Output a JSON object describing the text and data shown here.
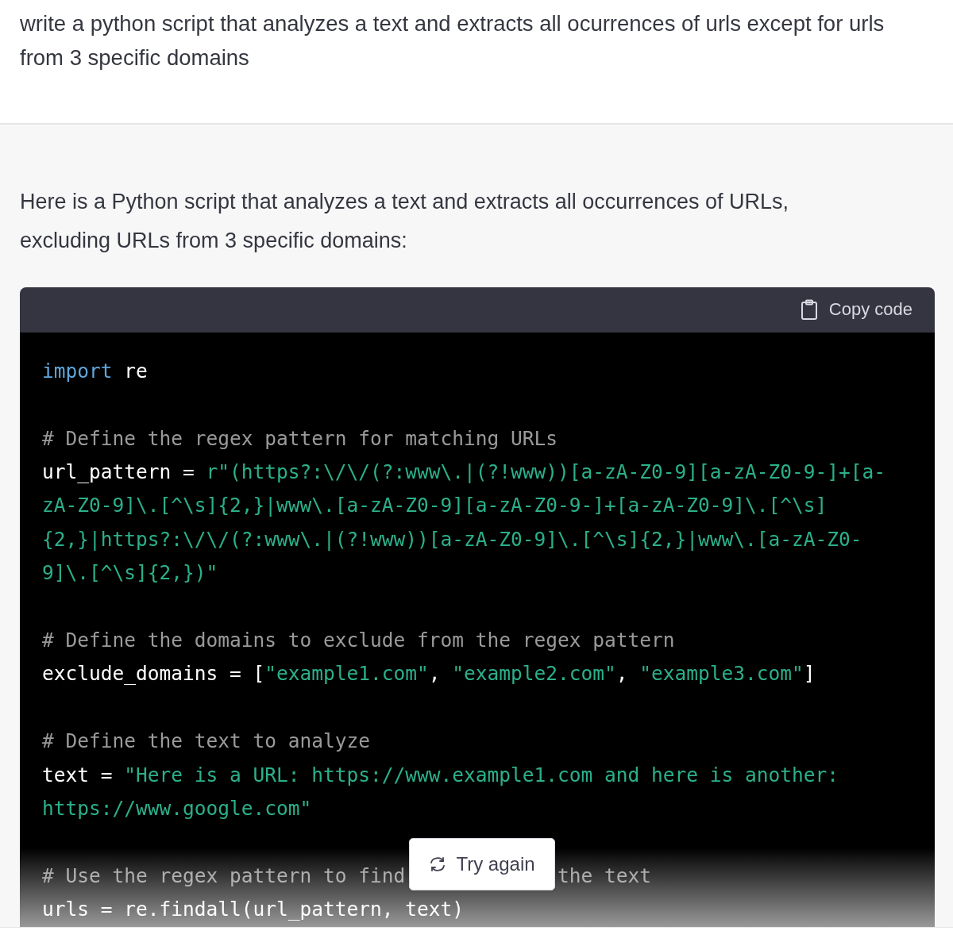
{
  "prompt": {
    "text": "write a python script that analyzes a text and extracts all ocurrences of urls except for urls from 3 specific domains"
  },
  "response": {
    "intro": "Here is a Python script that analyzes a text and extracts all occurrences of URLs, excluding URLs from 3 specific domains:",
    "code_block": {
      "copy_label": "Copy code",
      "lines": [
        {
          "kind": "code",
          "tokens": [
            {
              "kind": "keyword",
              "text": "import"
            },
            {
              "kind": "plain",
              "text": " re"
            }
          ]
        },
        {
          "kind": "blank"
        },
        {
          "kind": "code",
          "tokens": [
            {
              "kind": "comment",
              "text": "# Define the regex pattern for matching URLs"
            }
          ]
        },
        {
          "kind": "code",
          "tokens": [
            {
              "kind": "plain",
              "text": "url_pattern = "
            },
            {
              "kind": "string",
              "text": "r\"(https?:\\/\\/(?:www\\.|(?!www))[a-zA-Z0-9][a-zA-Z0-9-]+[a-"
            }
          ]
        },
        {
          "kind": "code",
          "tokens": [
            {
              "kind": "string",
              "text": "zA-Z0-9]\\.[^\\s]{2,}|www\\.[a-zA-Z0-9][a-zA-Z0-9-]+[a-zA-Z0-9]\\.[^\\s]"
            }
          ]
        },
        {
          "kind": "code",
          "tokens": [
            {
              "kind": "string",
              "text": "{2,}|https?:\\/\\/(?:www\\.|(?!www))[a-zA-Z0-9]\\.[^\\s]{2,}|www\\.[a-zA-Z0-"
            }
          ]
        },
        {
          "kind": "code",
          "tokens": [
            {
              "kind": "string",
              "text": "9]\\.[^\\s]{2,})\""
            }
          ]
        },
        {
          "kind": "blank"
        },
        {
          "kind": "code",
          "tokens": [
            {
              "kind": "comment",
              "text": "# Define the domains to exclude from the regex pattern"
            }
          ]
        },
        {
          "kind": "code",
          "tokens": [
            {
              "kind": "plain",
              "text": "exclude_domains = ["
            },
            {
              "kind": "string",
              "text": "\"example1.com\""
            },
            {
              "kind": "plain",
              "text": ", "
            },
            {
              "kind": "string",
              "text": "\"example2.com\""
            },
            {
              "kind": "plain",
              "text": ", "
            },
            {
              "kind": "string",
              "text": "\"example3.com\""
            },
            {
              "kind": "plain",
              "text": "]"
            }
          ]
        },
        {
          "kind": "blank"
        },
        {
          "kind": "code",
          "tokens": [
            {
              "kind": "comment",
              "text": "# Define the text to analyze"
            }
          ]
        },
        {
          "kind": "code",
          "tokens": [
            {
              "kind": "plain",
              "text": "text = "
            },
            {
              "kind": "string",
              "text": "\"Here is a URL: https://www.example1.com and here is another:"
            }
          ]
        },
        {
          "kind": "code",
          "tokens": [
            {
              "kind": "string",
              "text": "https://www.google.com\""
            }
          ]
        },
        {
          "kind": "blank"
        },
        {
          "kind": "split",
          "tokens": [
            {
              "kind": "comment",
              "text": "# Use the regex pattern to find"
            },
            {
              "kind": "comment",
              "text": "the text"
            }
          ]
        },
        {
          "kind": "code",
          "tokens": [
            {
              "kind": "plain",
              "text": "urls = re.findall(url_pattern, text)"
            }
          ]
        }
      ]
    }
  },
  "try_again": {
    "label": "Try again"
  }
}
